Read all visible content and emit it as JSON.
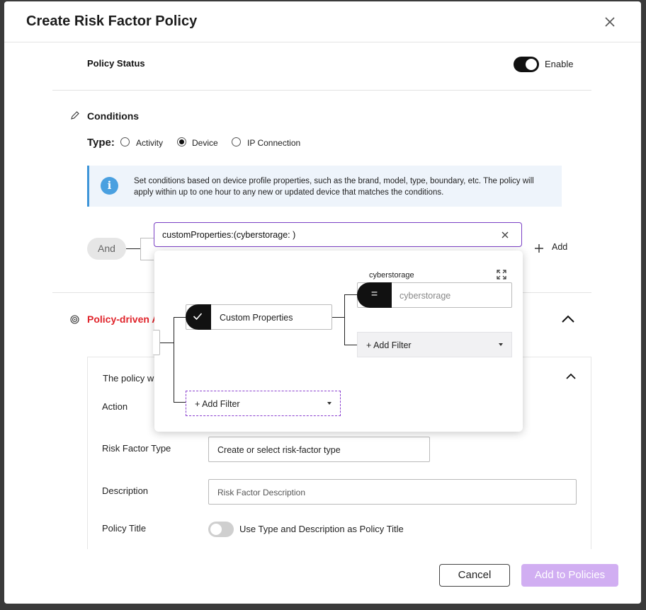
{
  "dialog": {
    "title": "Create Risk Factor Policy"
  },
  "policy_status": {
    "label": "Policy Status",
    "toggle_label": "Enable"
  },
  "conditions": {
    "heading": "Conditions",
    "type_label": "Type:",
    "types": [
      "Activity",
      "Device",
      "IP Connection"
    ],
    "selected_type": "Device",
    "info": "Set conditions based on device profile properties, such as the brand, model, type, boundary, etc. The policy will apply within up to one hour to any new or updated device that matches the conditions.",
    "operator": "And",
    "query": "customProperties:(cyberstorage: )",
    "add_label": "Add"
  },
  "filter_panel": {
    "root_node": "Custom Properties",
    "child_label": "cyberstorage",
    "child_placeholder": "cyberstorage",
    "child_operator": "=",
    "add_filter_inner": "+ Add Filter",
    "add_filter_outer": "+ Add Filter"
  },
  "policy_driven": {
    "heading": "Policy-driven A",
    "sub_heading": "The policy w",
    "action_label": "Action",
    "risk_factor_type_label": "Risk Factor Type",
    "risk_factor_type_value": "Create or select risk-factor type",
    "description_label": "Description",
    "description_placeholder": "Risk Factor Description",
    "policy_title_label": "Policy Title",
    "policy_title_toggle": "Use Type and Description as Policy Title"
  },
  "footer": {
    "cancel": "Cancel",
    "add": "Add to Policies"
  },
  "colors": {
    "accent": "#7a3fc4",
    "primary_disabled": "#d1aef2",
    "danger": "#e0242b",
    "info": "#4aa0e0"
  }
}
